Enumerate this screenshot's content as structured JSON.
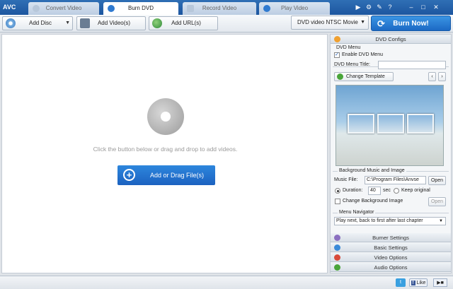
{
  "app": {
    "logo": "AVC"
  },
  "tabs": [
    {
      "label": "Convert Video"
    },
    {
      "label": "Burn DVD"
    },
    {
      "label": "Record Video"
    },
    {
      "label": "Play Video"
    }
  ],
  "toolbar": {
    "add_disc": "Add Disc",
    "add_videos": "Add Video(s)",
    "add_urls": "Add URL(s)",
    "format": "DVD video NTSC Movie",
    "burn_now": "Burn Now!"
  },
  "main": {
    "hint": "Click the button below or drag and drop to add videos.",
    "add_file": "Add or Drag File(s)"
  },
  "panel": {
    "dvd_configs": "DVD Configs",
    "dvd_menu_group": "DVD Menu",
    "enable_menu": "Enable DVD Menu",
    "enable_menu_checked": true,
    "menu_title_label": "DVD Menu Title:",
    "menu_title_value": "",
    "change_template": "Change Template",
    "bg_music_group": "Background Music and Image",
    "music_file_label": "Music File:",
    "music_file_value": "C:\\Program Files\\Anvse",
    "open_label": "Open",
    "duration_label": "Duration:",
    "duration_value": "40",
    "sec_label": "sec",
    "keep_original": "Keep original",
    "change_bg_image": "Change Background Image",
    "open_label_2": "Open",
    "menu_navigator_group": "Menu Navigator",
    "navigator_value": "Play next, back to first after last chapter",
    "burner_settings": "Burner Settings",
    "basic_settings": "Basic Settings",
    "video_options": "Video Options",
    "audio_options": "Audio Options"
  },
  "statusbar": {
    "like": "Like"
  },
  "colors": {
    "accent": "#1c69c4",
    "titlebar": "#2f6fb5"
  }
}
